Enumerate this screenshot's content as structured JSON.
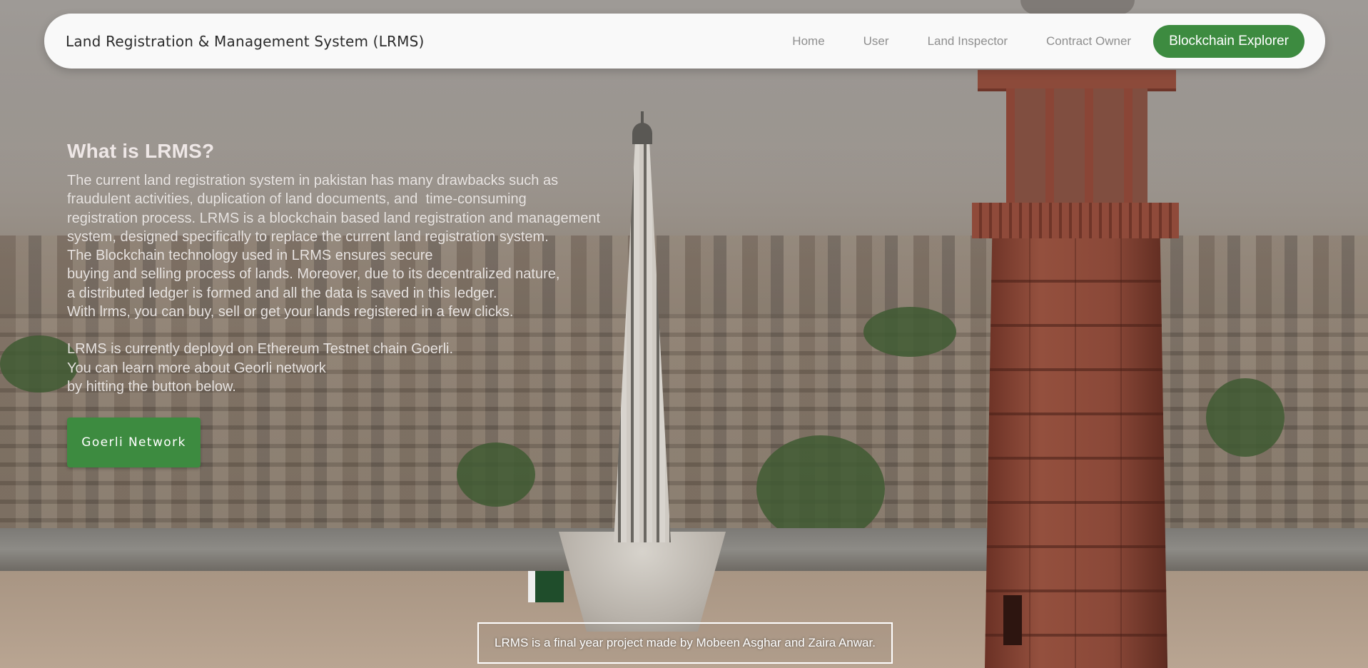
{
  "navbar": {
    "brand": "Land Registration & Management System (LRMS)",
    "links": [
      "Home",
      "User",
      "Land Inspector",
      "Contract Owner"
    ],
    "cta_label": "Blockchain Explorer",
    "cta_color": "#3d8b40"
  },
  "hero": {
    "title": "What is LRMS?",
    "paragraph1": [
      "The current land registration system in pakistan has many drawbacks such as",
      "fraudulent activities, duplication of land documents, and  time-consuming",
      "registration process. LRMS is a blockchain based land registration and management",
      "system, designed specifically to replace the current land registration system.",
      "The Blockchain technology used in LRMS ensures secure",
      "buying and selling process of lands. Moreover, due to its decentralized nature,",
      "a distributed ledger is formed and all the data is saved in this ledger.",
      "With lrms, you can buy, sell or get your lands registered in a few clicks."
    ],
    "paragraph2": [
      "LRMS is currently deployd on Ethereum Testnet chain Goerli.",
      "You can learn more about Georli network",
      "by hitting the button below."
    ],
    "button_label": "Goerli Network"
  },
  "footer": {
    "note": "LRMS is a final year project made by Mobeen Asghar and Zaira Anwar."
  }
}
